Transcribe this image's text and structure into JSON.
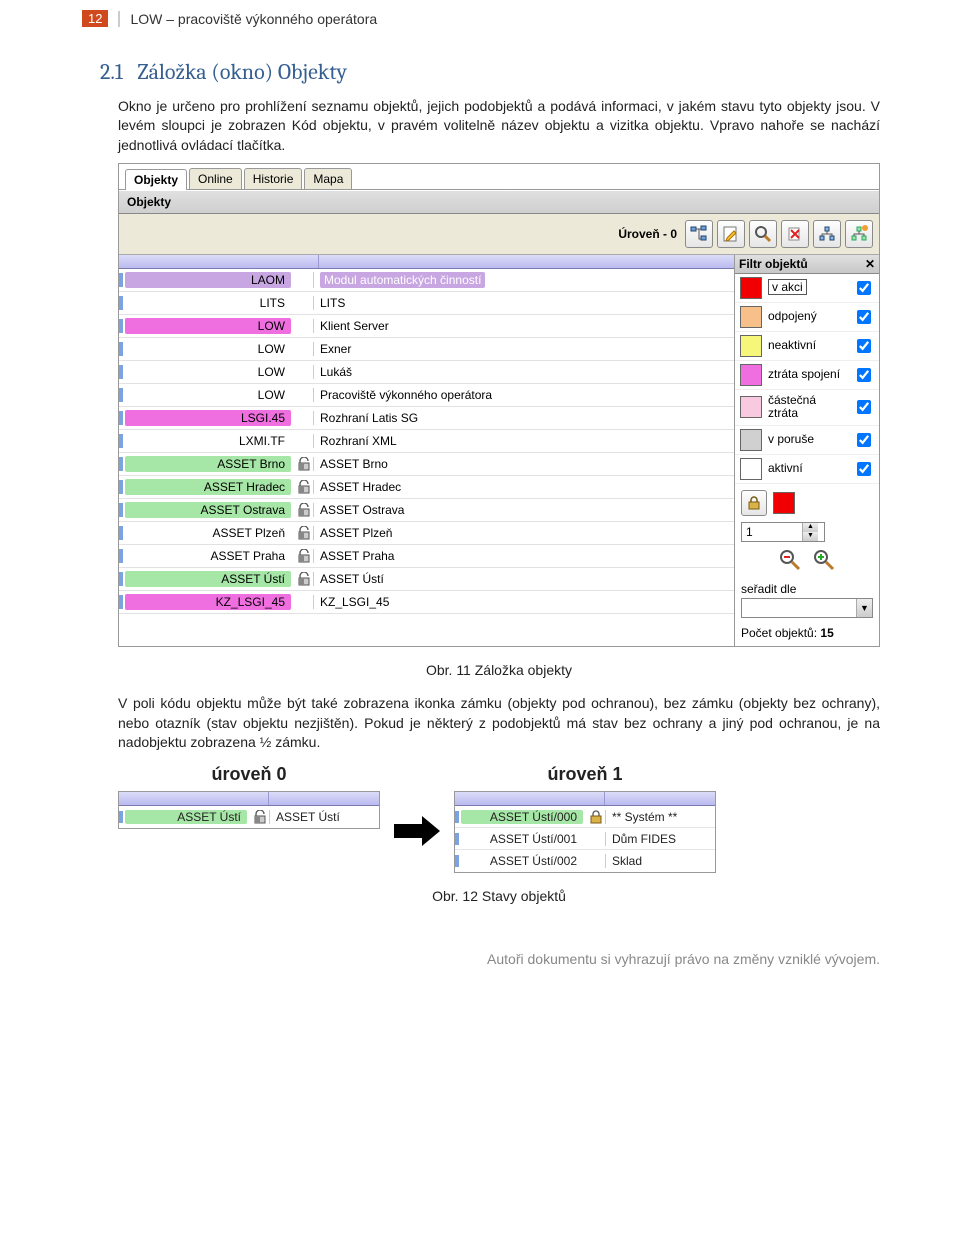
{
  "header": {
    "page_num": "12",
    "doc_title": "LOW – pracoviště výkonného operátora"
  },
  "section": {
    "number": "2.1",
    "title": "Záložka (okno) Objekty"
  },
  "para1": "Okno je určeno pro prohlížení seznamu objektů, jejich podobjektů a podává informaci, v jakém stavu tyto objekty jsou. V levém sloupci je zobrazen Kód objektu, v pravém volitelně název objektu a vizitka objektu. Vpravo nahoře se nachází jednotlivá ovládací tlačítka.",
  "caption1": "Obr. 11 Záložka objekty",
  "para2": "V poli kódu objektu může být také zobrazena ikonka zámku (objekty pod ochranou), bez zámku (objekty bez ochrany), nebo otazník (stav objektu nezjištěn). Pokud je některý z podobjektů má stav bez ochrany a jiný pod ochranou, je na nadobjektu zobrazena ½ zámku.",
  "caption2": "Obr. 12 Stavy objektů",
  "footer": "Autoři dokumentu si vyhrazují právo na změny vzniklé vývojem.",
  "shot1": {
    "tabs": [
      "Objekty",
      "Online",
      "Historie",
      "Mapa"
    ],
    "subheader": "Objekty",
    "level_label": "Úroveň - 0",
    "rows": [
      {
        "code": "LAOM",
        "name": "Modul automatických činností",
        "bg": "#c8a6e2",
        "sel": true,
        "lock": ""
      },
      {
        "code": "LITS",
        "name": "LITS",
        "bg": "",
        "lock": ""
      },
      {
        "code": "LOW",
        "name": "Klient Server",
        "bg": "#ef6fe0",
        "lock": ""
      },
      {
        "code": "LOW",
        "name": "Exner",
        "bg": "",
        "lock": ""
      },
      {
        "code": "LOW",
        "name": "Lukáš",
        "bg": "",
        "lock": ""
      },
      {
        "code": "LOW",
        "name": "Pracoviště výkonného operátora",
        "bg": "",
        "lock": ""
      },
      {
        "code": "LSGI.45",
        "name": "Rozhraní Latis SG",
        "bg": "#ef6fe0",
        "lock": ""
      },
      {
        "code": "LXMI.TF",
        "name": "Rozhraní XML",
        "bg": "",
        "lock": ""
      },
      {
        "code": "ASSET Brno",
        "name": "ASSET Brno",
        "bg": "#a6e6a6",
        "lock": "half"
      },
      {
        "code": "ASSET Hradec",
        "name": "ASSET Hradec",
        "bg": "#a6e6a6",
        "lock": "half"
      },
      {
        "code": "ASSET Ostrava",
        "name": "ASSET Ostrava",
        "bg": "#a6e6a6",
        "lock": "half"
      },
      {
        "code": "ASSET Plzeň",
        "name": "ASSET Plzeň",
        "bg": "",
        "lock": "half"
      },
      {
        "code": "ASSET Praha",
        "name": "ASSET Praha",
        "bg": "",
        "lock": "half"
      },
      {
        "code": "ASSET Ústí",
        "name": "ASSET Ústí",
        "bg": "#a6e6a6",
        "lock": "half"
      },
      {
        "code": "KZ_LSGI_45",
        "name": "KZ_LSGI_45",
        "bg": "#ef6fe0",
        "lock": ""
      }
    ],
    "filter": {
      "title": "Filtr objektů",
      "items": [
        {
          "lbl": "v akci",
          "color": "#f00000",
          "chk": true,
          "boxed": true
        },
        {
          "lbl": "odpojený",
          "color": "#f7c08a",
          "chk": true
        },
        {
          "lbl": "neaktivní",
          "color": "#f6f67a",
          "chk": true
        },
        {
          "lbl": "ztráta spojení",
          "color": "#ef6fe0",
          "chk": true
        },
        {
          "lbl": "částečná ztráta",
          "color": "#f9c9df",
          "chk": true,
          "multi": true
        },
        {
          "lbl": "v poruše",
          "color": "#d0d0d0",
          "chk": true
        },
        {
          "lbl": "aktivní",
          "color": "#ffffff",
          "chk": true
        }
      ],
      "spin_value": "1",
      "sort_label": "seřadit dle",
      "count_label": "Počet objektů:",
      "count_value": "15"
    }
  },
  "shot2": {
    "left_title": "úroveň 0",
    "right_title": "úroveň 1",
    "left_rows": [
      {
        "code": "ASSET Ústí",
        "name": "ASSET Ústí",
        "bg": "#a6e6a6",
        "lock": "half"
      }
    ],
    "right_rows": [
      {
        "code": "ASSET Ústí/000",
        "name": "** Systém **",
        "bg": "#a6e6a6",
        "lock": "full"
      },
      {
        "code": "ASSET Ústí/001",
        "name": "Dům FIDES",
        "bg": "",
        "lock": ""
      },
      {
        "code": "ASSET Ústí/002",
        "name": "Sklad",
        "bg": "",
        "lock": ""
      }
    ]
  }
}
